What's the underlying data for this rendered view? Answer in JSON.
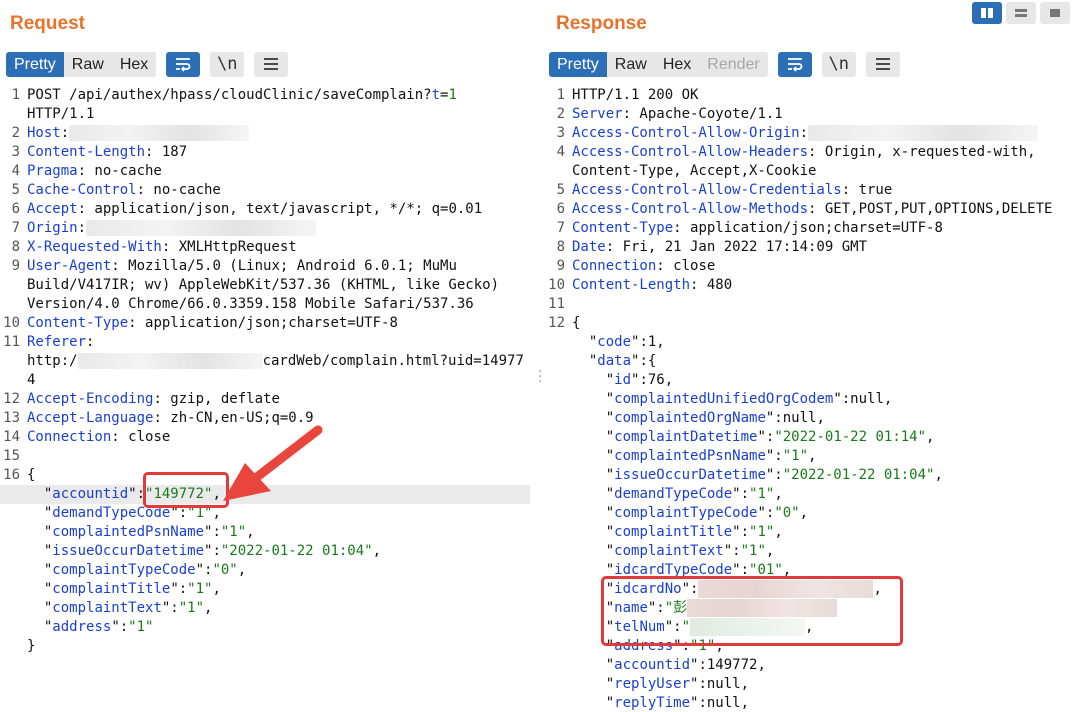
{
  "request": {
    "title": "Request",
    "tabs": [
      "Pretty",
      "Raw",
      "Hex"
    ],
    "active_tab": "Pretty",
    "icons": [
      "wrap-lines-icon",
      "newline-icon",
      "menu-icon"
    ],
    "lines": [
      {
        "num": "1",
        "parts": [
          [
            "t",
            "POST /api/authex/hpass/cloudClinic/saveComplain?"
          ],
          [
            "k",
            "t"
          ],
          [
            "t",
            "="
          ],
          [
            "s",
            "1"
          ]
        ]
      },
      {
        "num": "",
        "parts": [
          [
            "t",
            "HTTP/1.1"
          ]
        ]
      },
      {
        "num": "2",
        "parts": [
          [
            "k",
            "Host"
          ],
          [
            "t",
            ":"
          ]
        ],
        "blur": "host"
      },
      {
        "num": "3",
        "parts": [
          [
            "k",
            "Content-Length"
          ],
          [
            "t",
            ": 187"
          ]
        ]
      },
      {
        "num": "4",
        "parts": [
          [
            "k",
            "Pragma"
          ],
          [
            "t",
            ": no-cache"
          ]
        ]
      },
      {
        "num": "5",
        "parts": [
          [
            "k",
            "Cache-Control"
          ],
          [
            "t",
            ": no-cache"
          ]
        ]
      },
      {
        "num": "6",
        "parts": [
          [
            "k",
            "Accept"
          ],
          [
            "t",
            ": application/json, text/javascript, */*; q=0.01"
          ]
        ]
      },
      {
        "num": "7",
        "parts": [
          [
            "k",
            "Origin"
          ],
          [
            "t",
            ":"
          ]
        ],
        "blur": "origin"
      },
      {
        "num": "8",
        "parts": [
          [
            "k",
            "X-Requested-With"
          ],
          [
            "t",
            ": XMLHttpRequest"
          ]
        ]
      },
      {
        "num": "9",
        "parts": [
          [
            "k",
            "User-Agent"
          ],
          [
            "t",
            ": Mozilla/5.0 (Linux; Android 6.0.1; MuMu"
          ]
        ]
      },
      {
        "num": "",
        "parts": [
          [
            "t",
            "Build/V417IR; wv) AppleWebKit/537.36 (KHTML, like Gecko)"
          ]
        ]
      },
      {
        "num": "",
        "parts": [
          [
            "t",
            "Version/4.0 Chrome/66.0.3359.158 Mobile Safari/537.36"
          ]
        ]
      },
      {
        "num": "10",
        "parts": [
          [
            "k",
            "Content-Type"
          ],
          [
            "t",
            ": application/json;charset=UTF-8"
          ]
        ]
      },
      {
        "num": "11",
        "parts": [
          [
            "k",
            "Referer"
          ],
          [
            "t",
            ":"
          ]
        ]
      },
      {
        "num": "",
        "parts": [
          [
            "t",
            "http:/"
          ]
        ],
        "blur": "referer",
        "after": [
          [
            "t",
            "cardWeb/complain.html?uid=14977"
          ]
        ]
      },
      {
        "num": "",
        "parts": [
          [
            "t",
            "4"
          ]
        ]
      },
      {
        "num": "12",
        "parts": [
          [
            "k",
            "Accept-Encoding"
          ],
          [
            "t",
            ": gzip, deflate"
          ]
        ]
      },
      {
        "num": "13",
        "parts": [
          [
            "k",
            "Accept-Language"
          ],
          [
            "t",
            ": zh-CN,en-US;q=0.9"
          ]
        ]
      },
      {
        "num": "14",
        "parts": [
          [
            "k",
            "Connection"
          ],
          [
            "t",
            ": close"
          ]
        ]
      },
      {
        "num": "15",
        "parts": []
      },
      {
        "num": "16",
        "parts": [
          [
            "t",
            "{"
          ]
        ]
      },
      {
        "num": "",
        "parts": [
          [
            "t",
            "  \""
          ],
          [
            "k",
            "accountid"
          ],
          [
            "t",
            "\":"
          ],
          [
            "s",
            "\"149772\""
          ],
          [
            "t",
            ","
          ]
        ],
        "hl": true
      },
      {
        "num": "",
        "parts": [
          [
            "t",
            "  \""
          ],
          [
            "k",
            "demandTypeCode"
          ],
          [
            "t",
            "\":"
          ],
          [
            "s",
            "\"1\""
          ],
          [
            "t",
            ","
          ]
        ]
      },
      {
        "num": "",
        "parts": [
          [
            "t",
            "  \""
          ],
          [
            "k",
            "complaintedPsnName"
          ],
          [
            "t",
            "\":"
          ],
          [
            "s",
            "\"1\""
          ],
          [
            "t",
            ","
          ]
        ]
      },
      {
        "num": "",
        "parts": [
          [
            "t",
            "  \""
          ],
          [
            "k",
            "issueOccurDatetime"
          ],
          [
            "t",
            "\":"
          ],
          [
            "s",
            "\"2022-01-22 01:04\""
          ],
          [
            "t",
            ","
          ]
        ]
      },
      {
        "num": "",
        "parts": [
          [
            "t",
            "  \""
          ],
          [
            "k",
            "complaintTypeCode"
          ],
          [
            "t",
            "\":"
          ],
          [
            "s",
            "\"0\""
          ],
          [
            "t",
            ","
          ]
        ]
      },
      {
        "num": "",
        "parts": [
          [
            "t",
            "  \""
          ],
          [
            "k",
            "complaintTitle"
          ],
          [
            "t",
            "\":"
          ],
          [
            "s",
            "\"1\""
          ],
          [
            "t",
            ","
          ]
        ]
      },
      {
        "num": "",
        "parts": [
          [
            "t",
            "  \""
          ],
          [
            "k",
            "complaintText"
          ],
          [
            "t",
            "\":"
          ],
          [
            "s",
            "\"1\""
          ],
          [
            "t",
            ","
          ]
        ]
      },
      {
        "num": "",
        "parts": [
          [
            "t",
            "  \""
          ],
          [
            "k",
            "address"
          ],
          [
            "t",
            "\":"
          ],
          [
            "s",
            "\"1\""
          ]
        ]
      },
      {
        "num": "",
        "parts": [
          [
            "t",
            "}"
          ]
        ]
      }
    ]
  },
  "response": {
    "title": "Response",
    "tabs": [
      "Pretty",
      "Raw",
      "Hex",
      "Render"
    ],
    "active_tab": "Pretty",
    "disabled_tab": "Render",
    "icons": [
      "wrap-lines-icon",
      "newline-icon",
      "menu-icon"
    ],
    "lines": [
      {
        "num": "1",
        "parts": [
          [
            "t",
            "HTTP/1.1 200 OK"
          ]
        ]
      },
      {
        "num": "2",
        "parts": [
          [
            "k",
            "Server"
          ],
          [
            "t",
            ": Apache-Coyote/1.1"
          ]
        ]
      },
      {
        "num": "3",
        "parts": [
          [
            "k",
            "Access-Control-Allow-Origin"
          ],
          [
            "t",
            ":"
          ]
        ],
        "blur": "acao"
      },
      {
        "num": "4",
        "parts": [
          [
            "k",
            "Access-Control-Allow-Headers"
          ],
          [
            "t",
            ": Origin, x-requested-with,"
          ]
        ]
      },
      {
        "num": "",
        "parts": [
          [
            "t",
            "Content-Type, Accept,X-Cookie"
          ]
        ]
      },
      {
        "num": "5",
        "parts": [
          [
            "k",
            "Access-Control-Allow-Credentials"
          ],
          [
            "t",
            ": true"
          ]
        ]
      },
      {
        "num": "6",
        "parts": [
          [
            "k",
            "Access-Control-Allow-Methods"
          ],
          [
            "t",
            ": GET,POST,PUT,OPTIONS,DELETE"
          ]
        ]
      },
      {
        "num": "7",
        "parts": [
          [
            "k",
            "Content-Type"
          ],
          [
            "t",
            ": application/json;charset=UTF-8"
          ]
        ]
      },
      {
        "num": "8",
        "parts": [
          [
            "k",
            "Date"
          ],
          [
            "t",
            ": Fri, 21 Jan 2022 17:14:09 GMT"
          ]
        ]
      },
      {
        "num": "9",
        "parts": [
          [
            "k",
            "Connection"
          ],
          [
            "t",
            ": close"
          ]
        ]
      },
      {
        "num": "10",
        "parts": [
          [
            "k",
            "Content-Length"
          ],
          [
            "t",
            ": 480"
          ]
        ]
      },
      {
        "num": "11",
        "parts": []
      },
      {
        "num": "12",
        "parts": [
          [
            "t",
            "{"
          ]
        ]
      },
      {
        "num": "",
        "parts": [
          [
            "t",
            "  \""
          ],
          [
            "k",
            "code"
          ],
          [
            "t",
            "\":1,"
          ]
        ]
      },
      {
        "num": "",
        "parts": [
          [
            "t",
            "  \""
          ],
          [
            "k",
            "data"
          ],
          [
            "t",
            "\":{"
          ]
        ]
      },
      {
        "num": "",
        "parts": [
          [
            "t",
            "    \""
          ],
          [
            "k",
            "id"
          ],
          [
            "t",
            "\":76,"
          ]
        ]
      },
      {
        "num": "",
        "parts": [
          [
            "t",
            "    \""
          ],
          [
            "k",
            "complaintedUnifiedOrgCodem"
          ],
          [
            "t",
            "\":null,"
          ]
        ]
      },
      {
        "num": "",
        "parts": [
          [
            "t",
            "    \""
          ],
          [
            "k",
            "complaintedOrgName"
          ],
          [
            "t",
            "\":null,"
          ]
        ]
      },
      {
        "num": "",
        "parts": [
          [
            "t",
            "    \""
          ],
          [
            "k",
            "complaintDatetime"
          ],
          [
            "t",
            "\":"
          ],
          [
            "s",
            "\"2022-01-22 01:14\""
          ],
          [
            "t",
            ","
          ]
        ]
      },
      {
        "num": "",
        "parts": [
          [
            "t",
            "    \""
          ],
          [
            "k",
            "complaintedPsnName"
          ],
          [
            "t",
            "\":"
          ],
          [
            "s",
            "\"1\""
          ],
          [
            "t",
            ","
          ]
        ]
      },
      {
        "num": "",
        "parts": [
          [
            "t",
            "    \""
          ],
          [
            "k",
            "issueOccurDatetime"
          ],
          [
            "t",
            "\":"
          ],
          [
            "s",
            "\"2022-01-22 01:04\""
          ],
          [
            "t",
            ","
          ]
        ]
      },
      {
        "num": "",
        "parts": [
          [
            "t",
            "    \""
          ],
          [
            "k",
            "demandTypeCode"
          ],
          [
            "t",
            "\":"
          ],
          [
            "s",
            "\"1\""
          ],
          [
            "t",
            ","
          ]
        ]
      },
      {
        "num": "",
        "parts": [
          [
            "t",
            "    \""
          ],
          [
            "k",
            "complaintTypeCode"
          ],
          [
            "t",
            "\":"
          ],
          [
            "s",
            "\"0\""
          ],
          [
            "t",
            ","
          ]
        ]
      },
      {
        "num": "",
        "parts": [
          [
            "t",
            "    \""
          ],
          [
            "k",
            "complaintTitle"
          ],
          [
            "t",
            "\":"
          ],
          [
            "s",
            "\"1\""
          ],
          [
            "t",
            ","
          ]
        ]
      },
      {
        "num": "",
        "parts": [
          [
            "t",
            "    \""
          ],
          [
            "k",
            "complaintText"
          ],
          [
            "t",
            "\":"
          ],
          [
            "s",
            "\"1\""
          ],
          [
            "t",
            ","
          ]
        ]
      },
      {
        "num": "",
        "parts": [
          [
            "t",
            "    \""
          ],
          [
            "k",
            "idcardTypeCode"
          ],
          [
            "t",
            "\":"
          ],
          [
            "s",
            "\"01\""
          ],
          [
            "t",
            ","
          ]
        ]
      },
      {
        "num": "",
        "parts": [
          [
            "t",
            "    \""
          ],
          [
            "k",
            "idcardNo"
          ],
          [
            "t",
            "\":"
          ]
        ],
        "blur": "pink",
        "after": [
          [
            "t",
            ","
          ]
        ]
      },
      {
        "num": "",
        "parts": [
          [
            "t",
            "    \""
          ],
          [
            "k",
            "name"
          ],
          [
            "t",
            "\":"
          ],
          [
            "s",
            "\"彭"
          ]
        ],
        "blur": "pink-short"
      },
      {
        "num": "",
        "parts": [
          [
            "t",
            "    \""
          ],
          [
            "k",
            "telNum"
          ],
          [
            "t",
            "\":"
          ],
          [
            "s",
            "\""
          ]
        ],
        "blur": "green",
        "after": [
          [
            "t",
            ","
          ]
        ]
      },
      {
        "num": "",
        "parts": [
          [
            "t",
            "    \""
          ],
          [
            "k",
            "address"
          ],
          [
            "t",
            "\":"
          ],
          [
            "s",
            "\"1\""
          ],
          [
            "t",
            ","
          ]
        ]
      },
      {
        "num": "",
        "parts": [
          [
            "t",
            "    \""
          ],
          [
            "k",
            "accountid"
          ],
          [
            "t",
            "\":149772,"
          ]
        ]
      },
      {
        "num": "",
        "parts": [
          [
            "t",
            "    \""
          ],
          [
            "k",
            "replyUser"
          ],
          [
            "t",
            "\":null,"
          ]
        ]
      },
      {
        "num": "",
        "parts": [
          [
            "t",
            "    \""
          ],
          [
            "k",
            "replyTime"
          ],
          [
            "t",
            "\":null,"
          ]
        ]
      }
    ]
  },
  "colors": {
    "accent": "#2c6fb7",
    "title": "#e8722c",
    "highlight": "#e03a3a",
    "key": "#1a3fd0",
    "string": "#1a7a1a"
  }
}
